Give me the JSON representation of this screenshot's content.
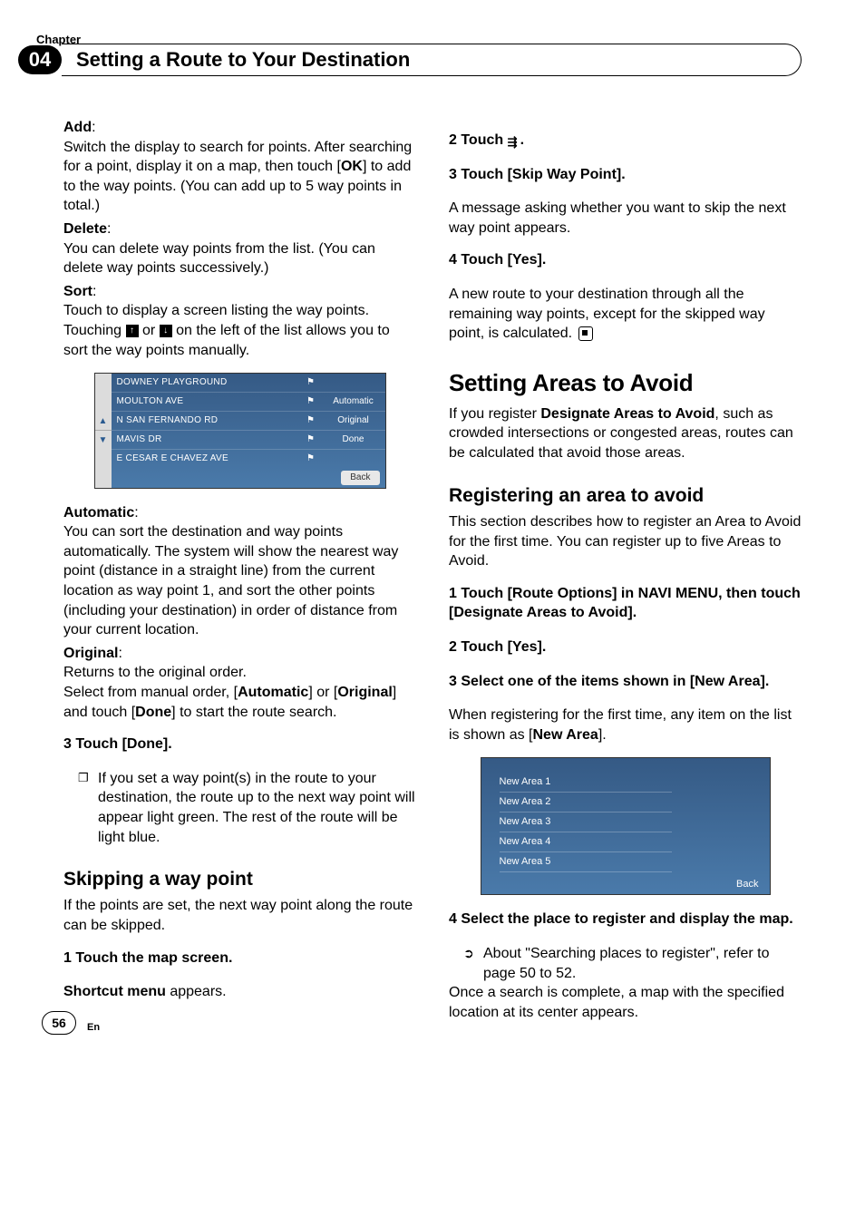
{
  "header": {
    "chapter_label": "Chapter",
    "chapter_num": "04",
    "title": "Setting a Route to Your Destination"
  },
  "left": {
    "add_label": "Add",
    "add_text": "Switch the display to search for points. After searching for a point, display it on a map, then touch [",
    "add_ok": "OK",
    "add_text2": "] to add to the way points. (You can add up to 5 way points in total.)",
    "delete_label": "Delete",
    "delete_text": "You can delete way points from the list. (You can delete way points successively.)",
    "sort_label": "Sort",
    "sort_text1": "Touch to display a screen listing the way points. Touching ",
    "sort_text2": " or ",
    "sort_text3": " on the left of the list allows you to sort the way points manually.",
    "screenshot1": {
      "rows": [
        {
          "label": "DOWNEY PLAYGROUND",
          "btn": ""
        },
        {
          "label": "MOULTON AVE",
          "btn": "Automatic"
        },
        {
          "label": "N SAN FERNANDO RD",
          "btn": "Original"
        },
        {
          "label": "MAVIS DR",
          "btn": "Done"
        },
        {
          "label": "E CESAR E CHAVEZ AVE",
          "btn": ""
        }
      ],
      "back": "Back"
    },
    "auto_label": "Automatic",
    "auto_text": "You can sort the destination and way points automatically. The system will show the nearest way point (distance in a straight line) from the current location as way point 1, and sort the other points (including your destination) in order of distance from your current location.",
    "orig_label": "Original",
    "orig_text1": "Returns to the original order.",
    "orig_text2a": "Select from manual order, [",
    "orig_auto": "Automatic",
    "orig_text2b": "] or [",
    "orig_orig": "Original",
    "orig_text2c": "] and touch [",
    "orig_done": "Done",
    "orig_text2d": "] to start the route search.",
    "step3": "3    Touch [Done].",
    "step3_note": "If you set a way point(s) in the route to your destination, the route up to the next way point will appear light green. The rest of the route will be light blue.",
    "skip_h": "Skipping a way point",
    "skip_text": "If the points are set, the next way point along the route can be skipped.",
    "skip_step1": "1    Touch the map screen.",
    "skip_step1_sub_a": "Shortcut menu",
    "skip_step1_sub_b": " appears."
  },
  "right": {
    "step2": "2    Touch ",
    "step2_end": ".",
    "step3": "3    Touch [Skip Way Point].",
    "step3_text": "A message asking whether you want to skip the next way point appears.",
    "step4": "4    Touch [Yes].",
    "step4_text": "A new route to your destination through all the remaining way points, except for the skipped way point, is calculated.",
    "areas_h": "Setting Areas to Avoid",
    "areas_text_a": "If you register ",
    "areas_bold": "Designate Areas to Avoid",
    "areas_text_b": ", such as crowded intersections or congested areas, routes can be calculated that avoid those areas.",
    "reg_h": "Registering an area to avoid",
    "reg_text": "This section describes how to register an Area to Avoid for the first time. You can register up to five Areas to Avoid.",
    "reg_step1": "1    Touch [Route Options] in NAVI MENU, then touch [Designate Areas to Avoid].",
    "reg_step2": "2    Touch [Yes].",
    "reg_step3": "3    Select one of the items shown in [New Area].",
    "reg_step3_text_a": "When registering for the first time, any item on the list is shown as [",
    "reg_step3_bold": "New Area",
    "reg_step3_text_b": "].",
    "screenshot2": {
      "items": [
        "New Area 1",
        "New Area 2",
        "New Area 3",
        "New Area 4",
        "New Area 5"
      ],
      "back": "Back"
    },
    "reg_step4": "4    Select the place to register and display the map.",
    "reg_step4_note": "About \"Searching places to register\", refer to page 50 to 52.",
    "reg_step4_text": "Once a search is complete, a map with the specified location at its center appears."
  },
  "footer": {
    "page": "56",
    "lang": "En"
  }
}
